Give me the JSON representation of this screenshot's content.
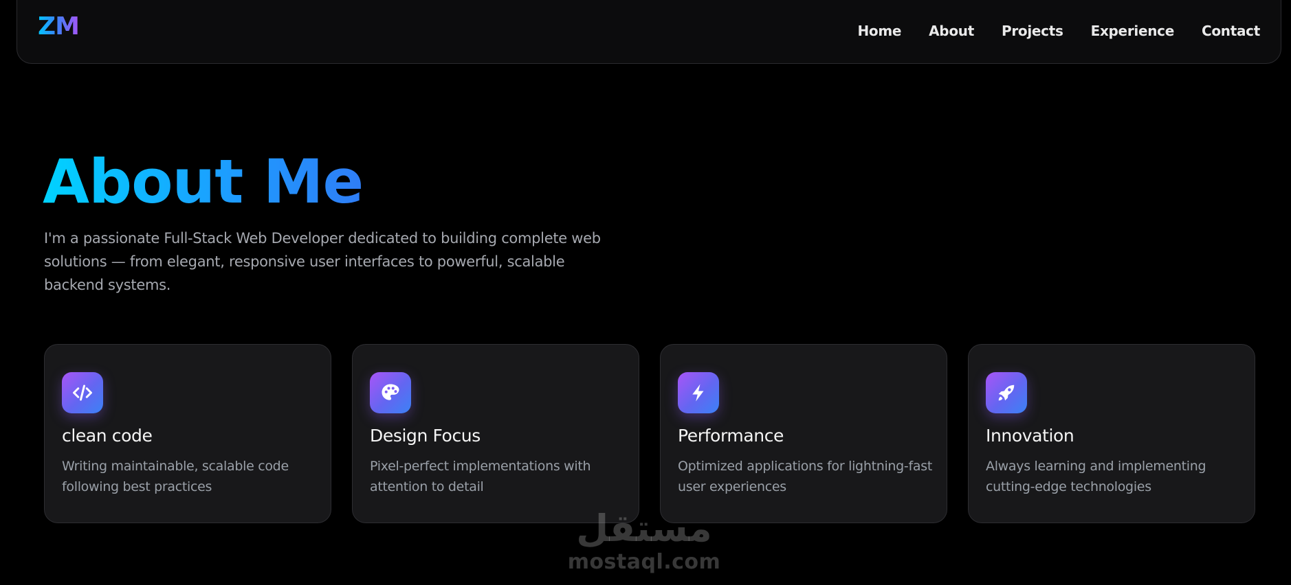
{
  "header": {
    "logo": "ZM",
    "nav": [
      {
        "label": "Home"
      },
      {
        "label": "About"
      },
      {
        "label": "Projects"
      },
      {
        "label": "Experience"
      },
      {
        "label": "Contact"
      }
    ]
  },
  "about": {
    "title": "About Me",
    "description": "I'm a passionate Full-Stack Web Developer dedicated to building complete web solutions — from elegant, responsive user interfaces to powerful, scalable backend systems."
  },
  "cards": [
    {
      "icon": "code-icon",
      "title": "clean code",
      "description": "Writing maintainable, scalable code following best practices"
    },
    {
      "icon": "palette-icon",
      "title": "Design Focus",
      "description": "Pixel-perfect implementations with attention to detail"
    },
    {
      "icon": "lightning-icon",
      "title": "Performance",
      "description": "Optimized applications for lightning-fast user experiences"
    },
    {
      "icon": "rocket-icon",
      "title": "Innovation",
      "description": "Always learning and implementing cutting-edge technologies"
    }
  ],
  "watermark": {
    "arabic": "مستقل",
    "latin": "mostaql.com"
  },
  "colors": {
    "background": "#000000",
    "accent_cyan": "#00d2ff",
    "accent_blue": "#3b82f6",
    "accent_purple": "#a855f7",
    "card_bg": "#18181a"
  }
}
